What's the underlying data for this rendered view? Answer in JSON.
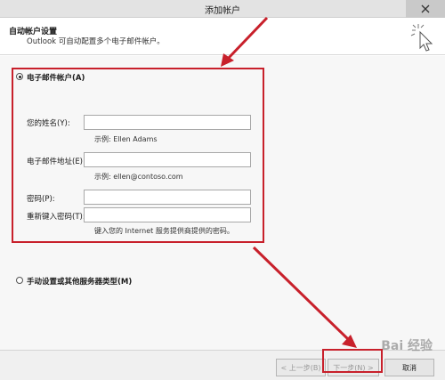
{
  "window": {
    "title": "添加帐户"
  },
  "header": {
    "heading": "自动帐户设置",
    "subtitle": "Outlook 可自动配置多个电子邮件帐户。"
  },
  "email_option": {
    "label": "电子邮件帐户(A)",
    "selected": true,
    "name_label": "您的姓名(Y):",
    "name_value": "",
    "name_hint": "示例: Ellen Adams",
    "email_label": "电子邮件地址(E):",
    "email_value": "",
    "email_hint": "示例: ellen@contoso.com",
    "password_label": "密码(P):",
    "password_value": "",
    "retype_label": "重新键入密码(T):",
    "retype_value": "",
    "password_hint": "键入您的 Internet 服务提供商提供的密码。"
  },
  "manual_option": {
    "label": "手动设置或其他服务器类型(M)",
    "selected": false
  },
  "footer": {
    "back_label": "< 上一步(B)",
    "next_label": "下一步(N) >",
    "cancel_label": "取消"
  },
  "watermark": "Bai 经验",
  "colors": {
    "annotation_red": "#c8202b"
  }
}
